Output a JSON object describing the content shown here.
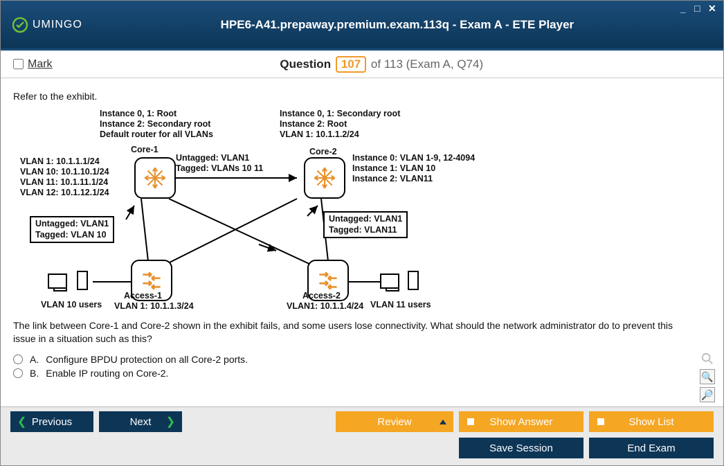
{
  "titlebar": {
    "app_name": "UMINGO",
    "title": "HPE6-A41.prepaway.premium.exam.113q - Exam A - ETE Player"
  },
  "question_bar": {
    "mark_label": "Mark",
    "question_word": "Question",
    "current": "107",
    "of_text": "of 113 (Exam A, Q74)"
  },
  "content": {
    "exhibit_ref": "Refer to the exhibit.",
    "question": "The link between Core-1 and Core-2 shown in the exhibit fails, and some users lose connectivity. What should the network administrator do to prevent this issue in a situation such as this?"
  },
  "diagram": {
    "core1_info": "Instance 0, 1: Root\nInstance 2: Secondary root\nDefault router for all VLANs",
    "core1_name": "Core-1",
    "core1_vlans": "VLAN 1: 10.1.1.1/24\nVLAN 10: 10.1.10.1/24\nVLAN 11: 10.1.11.1/24\nVLAN 12: 10.1.12.1/24",
    "core1_tag": "Untagged: VLAN1\nTagged: VLANs 10 11",
    "core2_info": "Instance 0, 1: Secondary root\nInstance 2: Root\nVLAN 1: 10.1.1.2/24",
    "core2_name": "Core-2",
    "core2_inst": "Instance 0: VLAN 1-9, 12-4094\nInstance 1: VLAN 10\nInstance 2: VLAN11",
    "box_left": "Untagged: VLAN1\nTagged: VLAN 10",
    "box_right": "Untagged: VLAN1\nTagged: VLAN11",
    "access1_name": "Access-1",
    "access1_vlan": "VLAN 1: 10.1.1.3/24",
    "access2_name": "Access-2",
    "access2_vlan": "VLAN1: 10.1.1.4/24",
    "vlan10_users": "VLAN 10 users",
    "vlan11_users": "VLAN 11 users"
  },
  "options": [
    {
      "letter": "A.",
      "text": "Configure BPDU protection on all Core-2 ports."
    },
    {
      "letter": "B.",
      "text": "Enable IP routing on Core-2."
    }
  ],
  "buttons": {
    "previous": "Previous",
    "next": "Next",
    "review": "Review",
    "show_answer": "Show Answer",
    "show_list": "Show List",
    "save_session": "Save Session",
    "end_exam": "End Exam"
  }
}
